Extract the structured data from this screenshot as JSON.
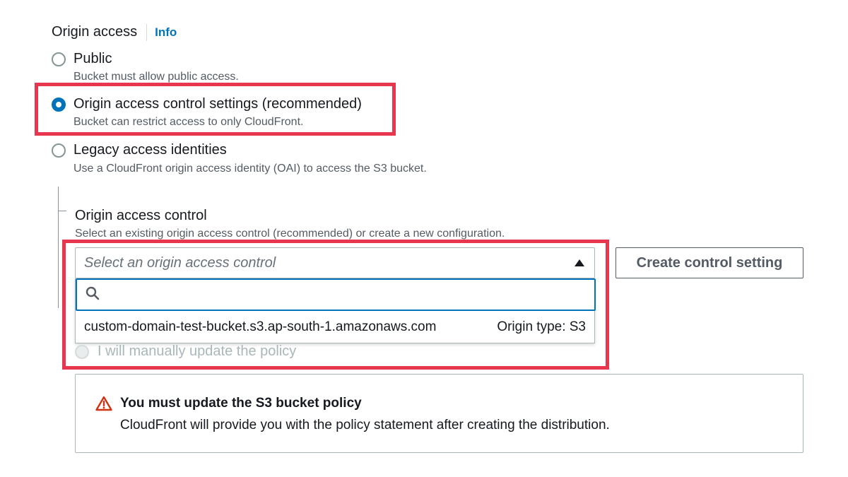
{
  "origin_access": {
    "title": "Origin access",
    "info_link": "Info",
    "options": [
      {
        "label": "Public",
        "description": "Bucket must allow public access.",
        "selected": false
      },
      {
        "label": "Origin access control settings (recommended)",
        "description": "Bucket can restrict access to only CloudFront.",
        "selected": true
      },
      {
        "label": "Legacy access identities",
        "description": "Use a CloudFront origin access identity (OAI) to access the S3 bucket.",
        "selected": false
      }
    ]
  },
  "origin_access_control": {
    "title": "Origin access control",
    "description": "Select an existing origin access control (recommended) or create a new configuration.",
    "select_placeholder": "Select an origin access control",
    "search_value": "",
    "dropdown_options": [
      {
        "name": "custom-domain-test-bucket.s3.ap-south-1.amazonaws.com",
        "meta": "Origin type: S3"
      }
    ],
    "create_button": "Create control setting"
  },
  "bucket_policy": {
    "manual_option": "I will manually update the policy"
  },
  "alert": {
    "title": "You must update the S3 bucket policy",
    "body": "CloudFront will provide you with the policy statement after creating the distribution.",
    "icon": "warning-icon"
  },
  "colors": {
    "accent": "#0073bb",
    "highlight": "#e8364f",
    "warning": "#d13212"
  }
}
